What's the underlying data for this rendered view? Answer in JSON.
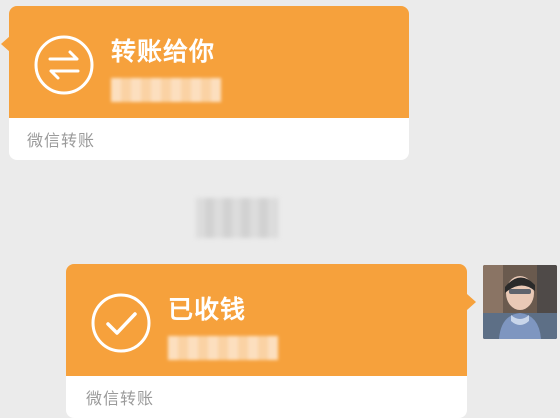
{
  "chat": {
    "received_transfer": {
      "title": "转账给你",
      "footer": "微信转账",
      "icon": "transfer-arrows-icon",
      "amount_obscured": true
    },
    "sent_transfer": {
      "title": "已收钱",
      "footer": "微信转账",
      "icon": "checkmark-icon",
      "amount_obscured": true
    },
    "timestamp_obscured": true,
    "avatar_icon": "user-avatar-photo"
  },
  "colors": {
    "card_orange": "#f6a13c",
    "card_footer_bg": "#ffffff",
    "footer_text": "#9a9a9a",
    "chat_bg": "#ebebeb"
  }
}
